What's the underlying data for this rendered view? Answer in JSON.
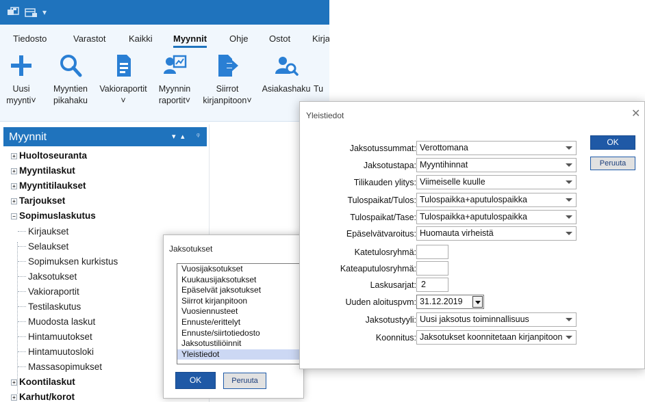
{
  "quick_access": {
    "icon": "save-icon",
    "icon2": "calendar-icon",
    "dropdown": "▾"
  },
  "ribbon_tabs": [
    "Tiedosto",
    "Varastot",
    "Kaikki",
    "Myynnit",
    "Ohje",
    "Ostot",
    "Kirja"
  ],
  "ribbon_buttons": [
    {
      "line1": "Uusi",
      "line2": "myynti",
      "icon": "plus-icon",
      "has_dropdown": true
    },
    {
      "line1": "Myyntien",
      "line2": "pikahaku",
      "icon": "search-icon",
      "has_dropdown": false
    },
    {
      "line1": "Vakioraportit",
      "line2": "",
      "icon": "document-icon",
      "has_dropdown": true
    },
    {
      "line1": "Myynnin",
      "line2": "raportit",
      "icon": "chart-report-icon",
      "has_dropdown": true
    },
    {
      "line1": "Siirrot",
      "line2": "kirjanpitoon",
      "icon": "export-arrow-icon",
      "has_dropdown": true
    },
    {
      "line1": "Asiakashaku",
      "line2": "",
      "icon": "customer-search-icon",
      "has_dropdown": false
    },
    {
      "line1": "Tu",
      "line2": "",
      "icon": "",
      "has_dropdown": false
    }
  ],
  "panel": {
    "title": "Myynnit",
    "tree": [
      {
        "label": "Huoltoseuranta",
        "bold": true,
        "expander": "+"
      },
      {
        "label": "Myyntilaskut",
        "bold": true,
        "expander": "+"
      },
      {
        "label": "Myyntitilaukset",
        "bold": true,
        "expander": "+"
      },
      {
        "label": "Tarjoukset",
        "bold": true,
        "expander": "+"
      },
      {
        "label": "Sopimuslaskutus",
        "bold": true,
        "expander": "−"
      },
      {
        "label": "Kirjaukset",
        "bold": false
      },
      {
        "label": "Selaukset",
        "bold": false
      },
      {
        "label": "Sopimuksen kurkistus",
        "bold": false
      },
      {
        "label": "Jaksotukset",
        "bold": false
      },
      {
        "label": "Vakioraportit",
        "bold": false
      },
      {
        "label": "Testilaskutus",
        "bold": false
      },
      {
        "label": "Muodosta laskut",
        "bold": false
      },
      {
        "label": "Hintamuutokset",
        "bold": false
      },
      {
        "label": "Hintamuutosloki",
        "bold": false
      },
      {
        "label": "Massasopimukset",
        "bold": false
      },
      {
        "label": "Koontilaskut",
        "bold": true,
        "expander": "+"
      },
      {
        "label": "Karhut/korot",
        "bold": true,
        "expander": "+"
      }
    ]
  },
  "jaksotukset_dialog": {
    "title": "Jaksotukset",
    "items": [
      "Vuosijaksotukset",
      "Kuukausijaksotukset",
      "Epäselvät jaksotukset",
      "Siirrot kirjanpitoon",
      "Vuosiennusteet",
      "Ennuste/erittelyt",
      "Ennuste/siirtotiedosto",
      "Jaksotustiliöinnit",
      "Yleistiedot"
    ],
    "selected": "Yleistiedot",
    "ok": "OK",
    "cancel": "Peruuta"
  },
  "yleistiedot_dialog": {
    "title": "Yleistiedot",
    "close": "✕",
    "ok": "OK",
    "cancel": "Peruuta",
    "fields": [
      {
        "label": "Jaksotussummat:",
        "type": "combo",
        "value": "Verottomana"
      },
      {
        "label": "Jaksotustapa:",
        "type": "combo",
        "value": "Myyntihinnat"
      },
      {
        "label": "Tilikauden ylitys:",
        "type": "combo",
        "value": "Viimeiselle kuulle"
      },
      {
        "label": "Tulospaikat/Tulos:",
        "type": "combo",
        "value": "Tulospaikka+aputulospaikka"
      },
      {
        "label": "Tulospaikat/Tase:",
        "type": "combo",
        "value": "Tulospaikka+aputulospaikka"
      },
      {
        "label": "Epäselvätvaroitus:",
        "type": "combo",
        "value": "Huomauta virheistä"
      },
      {
        "label": "Katetulosryhmä:",
        "type": "text",
        "value": ""
      },
      {
        "label": "Kateaputulosryhmä:",
        "type": "text",
        "value": ""
      },
      {
        "label": "Laskusarjat:",
        "type": "text",
        "value": "2"
      },
      {
        "label": "Uuden aloituspvm:",
        "type": "date",
        "value": "31.12.2019"
      },
      {
        "label": "Jaksotustyyli:",
        "type": "combo",
        "value": "Uusi jaksotus toiminnallisuus"
      },
      {
        "label": "Koonnitus:",
        "type": "combo",
        "value": "Jaksotukset koonnitetaan kirjanpitoon"
      }
    ]
  },
  "colors": {
    "accent": "#1f73bd",
    "ribbon_bg": "#f1f7fd",
    "ok_button": "#1f59a6",
    "selection": "#ccd8f4"
  }
}
